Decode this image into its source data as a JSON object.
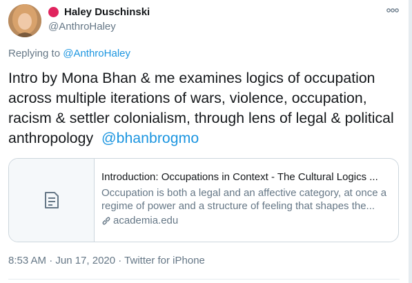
{
  "tweet": {
    "display_name": "Haley Duschinski",
    "handle": "@AnthroHaley",
    "replying_prefix": "Replying to",
    "replying_to": "@AnthroHaley",
    "text_main": "Intro by Mona Bhan & me examines logics of occupation across multiple iterations of wars, violence, occupation, racism & settler colonialism, through lens of legal & political anthropology",
    "text_mention": "@bhanbrogmo",
    "timestamp": "8:53 AM · Jun 17, 2020 · Twitter for iPhone"
  },
  "card": {
    "title": "Introduction: Occupations in Context - The Cultural Logics ...",
    "description": "Occupation is both a legal and an affective category, at once a regime of power and a structure of feeling that shapes the...",
    "domain": "academia.edu"
  },
  "icons": {
    "more": "more-dots-icon",
    "card_thumb": "document-icon",
    "domain": "link-icon",
    "status": "status-dot-icon"
  },
  "colors": {
    "link": "#1b95e0",
    "status_dot": "#e0245e",
    "secondary_text": "#657786"
  }
}
